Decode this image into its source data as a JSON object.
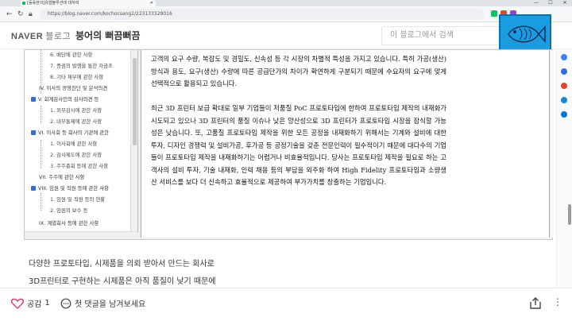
{
  "browser": {
    "tab_title": "[동육현의]유협블루션에 대하여",
    "url": "https://blog.naver.com/kochocsang2/223133329016",
    "window_controls": [
      "—",
      "☐",
      "✕"
    ]
  },
  "blog_header": {
    "logo": "NAVER",
    "logo_sub": "블로그",
    "blog_name": "붕어의 뻐끔뻐끔",
    "search_placeholder": "이 블로그에서 검색"
  },
  "toc": {
    "items": [
      {
        "label": "6. 배당에 관한 사항",
        "checked": false
      },
      {
        "label": "7. 증권의 발행을 통한 자금조",
        "checked": false
      },
      {
        "label": "8. 기타 재무에 관한 사항",
        "checked": false
      },
      {
        "label": "IV. 이사의 경영진단 및 분석의견",
        "checked": false
      },
      {
        "label": "V. 회계감사인의 감사의견 등",
        "checked": true
      },
      {
        "label": "1. 외부감사에 관한 사항",
        "checked": false
      },
      {
        "label": "2. 내부통제에 관한 사항",
        "checked": false
      },
      {
        "label": "VI. 이사회 등 회사의 기관에 관한",
        "checked": true
      },
      {
        "label": "1. 이사회에 관한 사항",
        "checked": false
      },
      {
        "label": "2. 감사제도에 관한 사항",
        "checked": false
      },
      {
        "label": "3. 주주총회 등에 관한 사항",
        "checked": false
      },
      {
        "label": "VII. 주주에 관한 사항",
        "checked": false
      },
      {
        "label": "VIII. 임원 및 직원 등에 관한 사항",
        "checked": true
      },
      {
        "label": "1. 임원 및 직원 등의 현황",
        "checked": false
      },
      {
        "label": "2. 임원의 보수 등",
        "checked": false
      },
      {
        "label": "IX. 계열회사 등에 관한 사항",
        "checked": false
      }
    ]
  },
  "document": {
    "para1": "고객의 요구 수량, 복잡도 및 경밀도, 신속성 등 각 시장의 차별적 특성을 가지고 있습니다. 특히 가공(생산)방식과 용도, 요구(생산) 수량에 따른 공급단가의 차이가 확연하게 구분되기 때문에 수요자의 요구에 맞게 선택적으로 활용되고 있습니다.",
    "para2": "최근 3D 프린터 보급 확대로 일부 기업들이 저품질 PoC 프로토타입에 한하여 프로토타입 제작의 내재화가 시도되고 있으나 3D 프린터의 품질 이슈나 낮은 양산성으로 3D 프린터가 프로토타입 시장을 잠식할 가능성은 낮습니다. 또, 고품질 프로토타입 제작을 위한 모든 공정을 내재화하기 위해서는 기계와 설비에 대한 투자, 디자인 경쟁력 및 설비가공, 후가공 등 공정기술을 갖춘 전문인력이 필수적이기 때문에 대다수의 기업들이 프로토타입 제작을 내재화하기는 어렵거나 비효율적입니다. 당사는 프로토타입 제작을 필요로 하는 고객사의 설비 투자, 기술 내재화, 인력 채용 등의 부담을 외주화 하여 High Fidelity 프로토타입과 소량생산 서비스를 보다 더 신속하고 효율적으로 제공하여 부가가치를 창출하는 기업입니다."
  },
  "blog_text": {
    "line1": "다양한 프로토타입, 시제품을 의뢰 받아서 만드는 회사로",
    "line2": "3D프린터로 구현하는 시제품은 아직 품질이 낮기 때문에"
  },
  "bottom": {
    "like_label": "공감",
    "like_count": "1",
    "comment_label": "첫 댓글을 남겨보세요"
  },
  "colors": {
    "naver_green": "#03c75a",
    "checkbox_blue": "#2f6fd6",
    "heart_red": "#e0395b",
    "thumb_blue": "#1a9de0"
  }
}
